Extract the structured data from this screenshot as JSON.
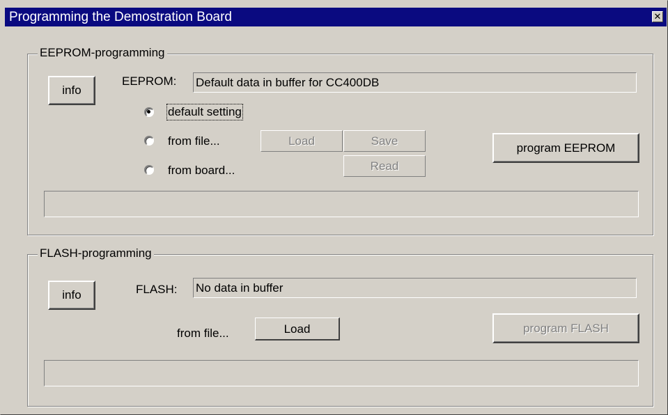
{
  "window": {
    "title": "Programming the Demostration Board",
    "close_glyph": "✕"
  },
  "eeprom": {
    "group_label": "EEPROM-programming",
    "info_label": "info",
    "field_label": "EEPROM:",
    "field_value": "Default data in buffer for CC400DB",
    "radios": [
      {
        "label": "default setting",
        "checked": true
      },
      {
        "label": "from file...",
        "checked": false
      },
      {
        "label": "from board...",
        "checked": false
      }
    ],
    "load_label": "Load",
    "save_label": "Save",
    "read_label": "Read",
    "program_label": "program EEPROM",
    "status_text": ""
  },
  "flash": {
    "group_label": "FLASH-programming",
    "info_label": "info",
    "field_label": "FLASH:",
    "field_value": "No data in buffer",
    "from_file_label": "from file...",
    "load_label": "Load",
    "program_label": "program FLASH",
    "status_text": ""
  }
}
